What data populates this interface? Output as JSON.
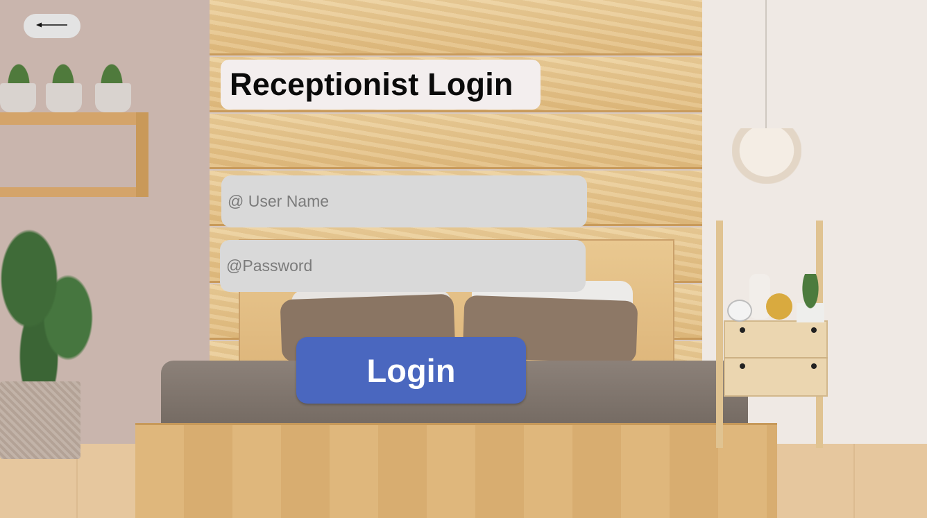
{
  "header": {
    "back_button_icon": "arrow-left-icon",
    "title": "Receptionist Login"
  },
  "form": {
    "username": {
      "placeholder": "@ User Name",
      "value": ""
    },
    "password": {
      "placeholder": "@Password",
      "value": ""
    },
    "submit_label": "Login"
  },
  "colors": {
    "login_button": "#4a67bf",
    "input_background": "#d9d9d9",
    "title_background": "#f3eeee",
    "back_button_background": "#e3e3e3"
  }
}
